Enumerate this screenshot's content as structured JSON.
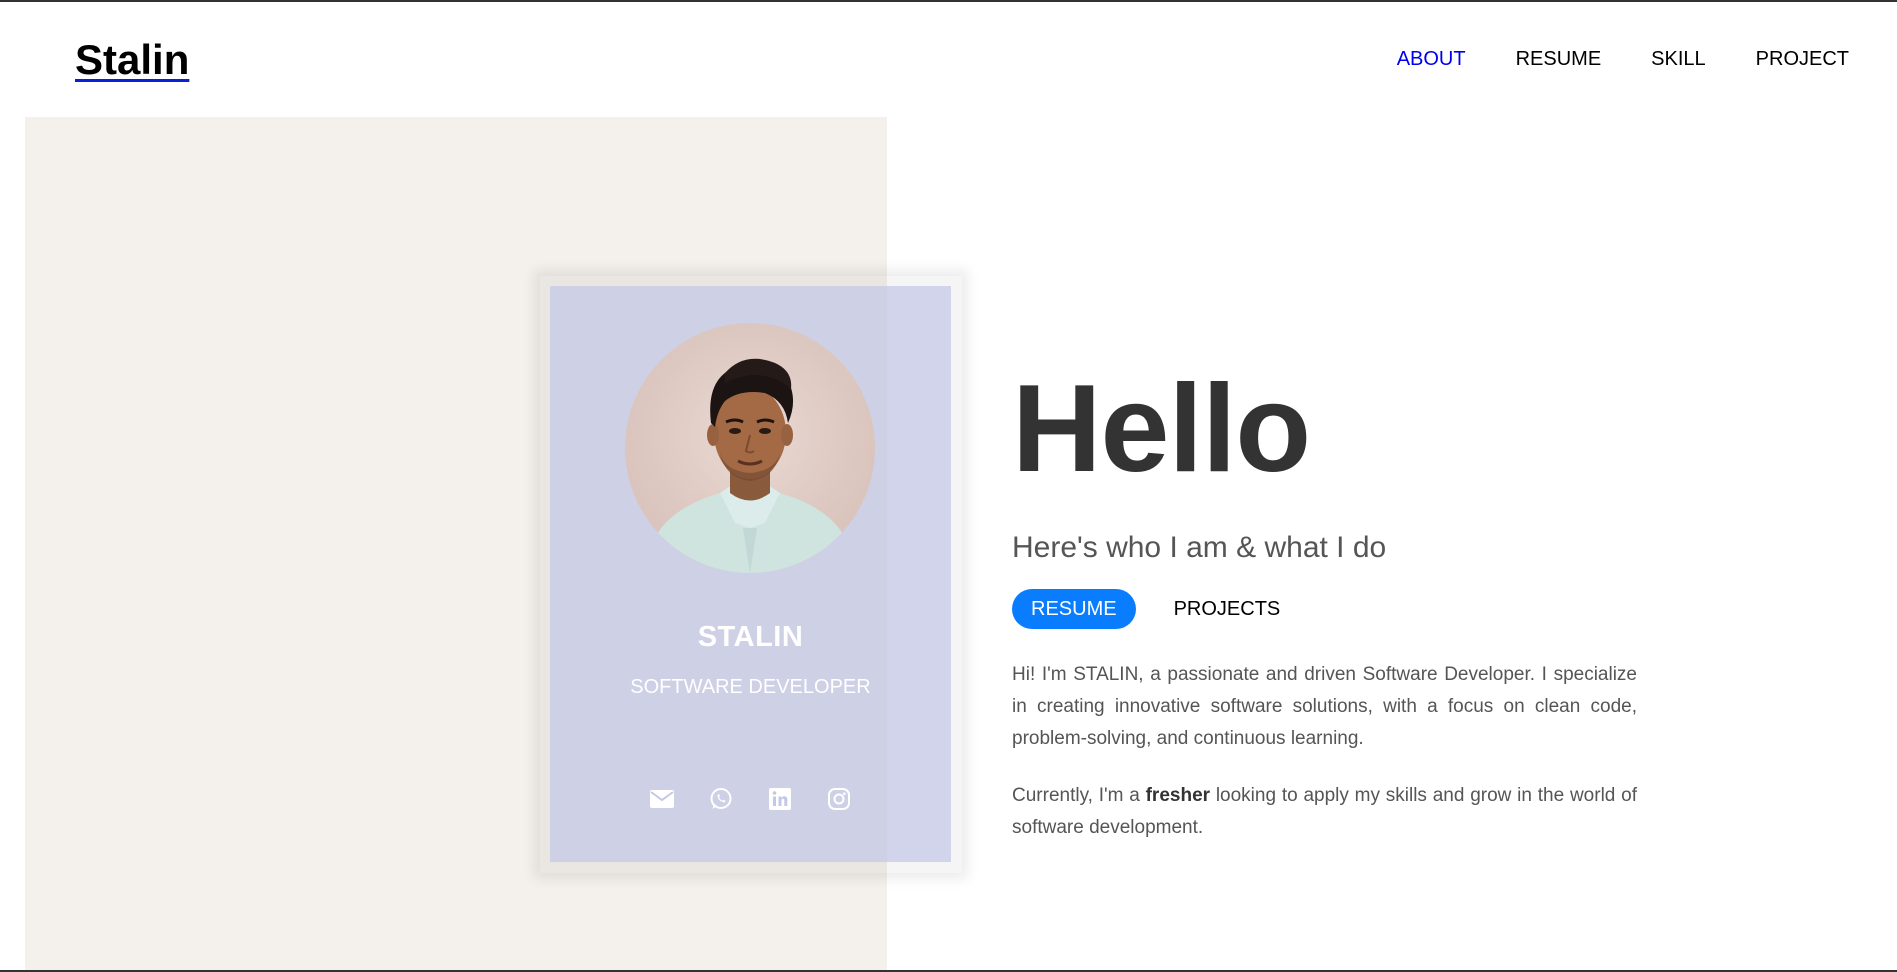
{
  "header": {
    "logo": "Stalin",
    "nav": [
      {
        "label": "ABOUT",
        "active": true
      },
      {
        "label": "RESUME",
        "active": false
      },
      {
        "label": "SKILL",
        "active": false
      },
      {
        "label": "PROJECT",
        "active": false
      }
    ]
  },
  "profile_card": {
    "name": "STALIN",
    "role": "SOFTWARE DEVELOPER",
    "photo": "profile-photo",
    "socials": [
      "envelope-icon",
      "whatsapp-icon",
      "linkedin-icon",
      "instagram-icon"
    ]
  },
  "hero": {
    "heading": "Hello",
    "subtitle": "Here's who I am & what I do",
    "buttons": {
      "primary": "RESUME",
      "secondary": "PROJECTS"
    },
    "intro": "Hi! I'm STALIN, a passionate and driven Software Developer. I specialize in creating innovative software solutions, with a focus on clean code, problem-solving, and continuous learning.",
    "current_prefix": "Currently, I'm a ",
    "current_bold": "fresher",
    "current_suffix": " looking to apply my skills and grow in the world of software development."
  },
  "colors": {
    "accent": "#0a7dff",
    "nav_active": "#0000ee",
    "panel_beige": "#f4f0ec",
    "card_lavender": "#c4c8e8",
    "heading": "#333333",
    "body_text": "#555555"
  }
}
